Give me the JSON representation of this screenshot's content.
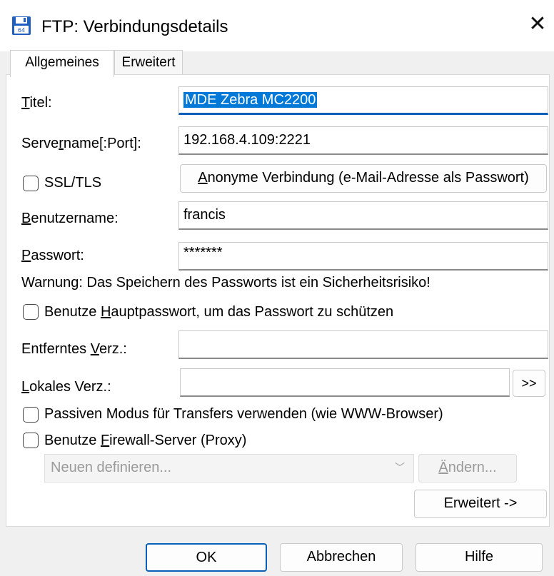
{
  "window": {
    "title": "FTP: Verbindungsdetails",
    "close_label": "✕",
    "icon": "ftp-floppy-icon",
    "accent": "#0078d7"
  },
  "tabs": [
    {
      "label": "Allgemeines",
      "active": true
    },
    {
      "label": "Erweitert",
      "active": false
    }
  ],
  "form": {
    "titel_label": "Titel:",
    "titel_value": "MDE Zebra MC2200",
    "server_label": "Servername[:Port]:",
    "server_value": "192.168.4.109:2221",
    "ssl_label": "SSL/TLS",
    "anon_button": "Anonyme Verbindung (e-Mail-Adresse als Passwort)",
    "user_label": "Benutzername:",
    "user_value": "francis",
    "pass_label": "Passwort:",
    "pass_value": "*******",
    "warning": "Warnung: Das Speichern des Passworts ist ein Sicherheitsrisiko!",
    "master_pw_label": "Benutze Hauptpasswort, um das Passwort zu schützen",
    "remote_label": "Entferntes Verz.:",
    "remote_value": "",
    "local_label": "Lokales Verz.:",
    "local_value": "",
    "browse_button": ">>",
    "passive_label": "Passiven Modus für Transfers verwenden (wie WWW-Browser)",
    "firewall_label": "Benutze Firewall-Server (Proxy)",
    "proxy_select": "Neuen definieren...",
    "change_button": "Ändern...",
    "advanced_button": "Erweitert ->"
  },
  "footer": {
    "ok": "OK",
    "cancel": "Abbrechen",
    "help": "Hilfe"
  }
}
